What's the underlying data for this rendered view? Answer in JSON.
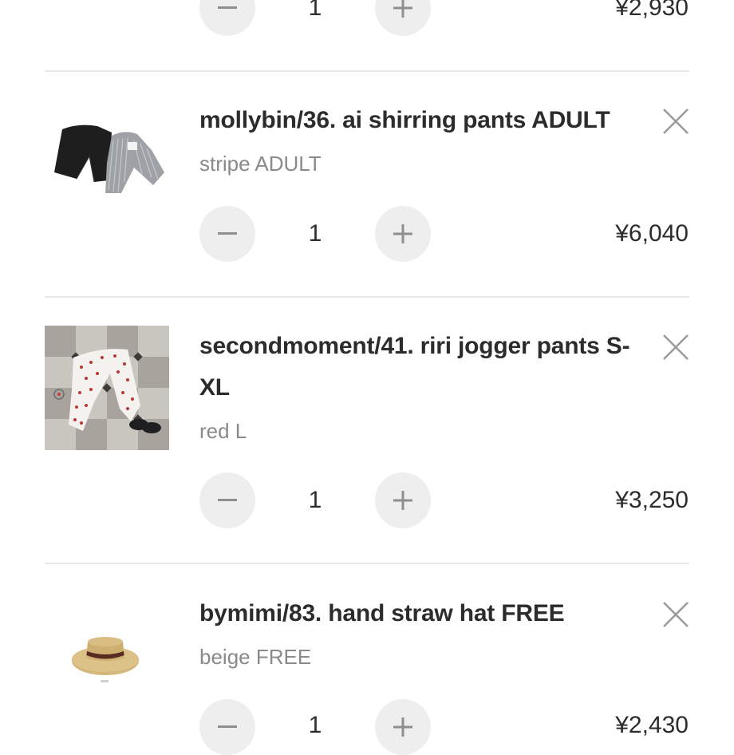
{
  "cart": {
    "items": [
      {
        "title": "",
        "variant": "",
        "quantity": "1",
        "price": "¥2,930"
      },
      {
        "title": "mollybin/36. ai shirring pants ADULT",
        "variant": "stripe ADULT",
        "quantity": "1",
        "price": "¥6,040",
        "thumbnail": "black and grey stripe pants"
      },
      {
        "title": "secondmoment/41. riri jogger pants S-XL",
        "variant": "red L",
        "quantity": "1",
        "price": "¥3,250",
        "thumbnail": "white cherry-print jogger pants on tiled floor"
      },
      {
        "title": "bymimi/83. hand straw hat FREE",
        "variant": "beige FREE",
        "quantity": "1",
        "price": "¥2,430",
        "thumbnail": "beige straw boater hat"
      }
    ],
    "icons": {
      "decrement": "minus-icon",
      "increment": "plus-icon",
      "remove": "close-icon"
    },
    "colors": {
      "button_bg": "#eeeeee",
      "divider": "#e9e9e9",
      "text": "#2c2c2c",
      "muted_text": "#8a8a8a"
    }
  }
}
